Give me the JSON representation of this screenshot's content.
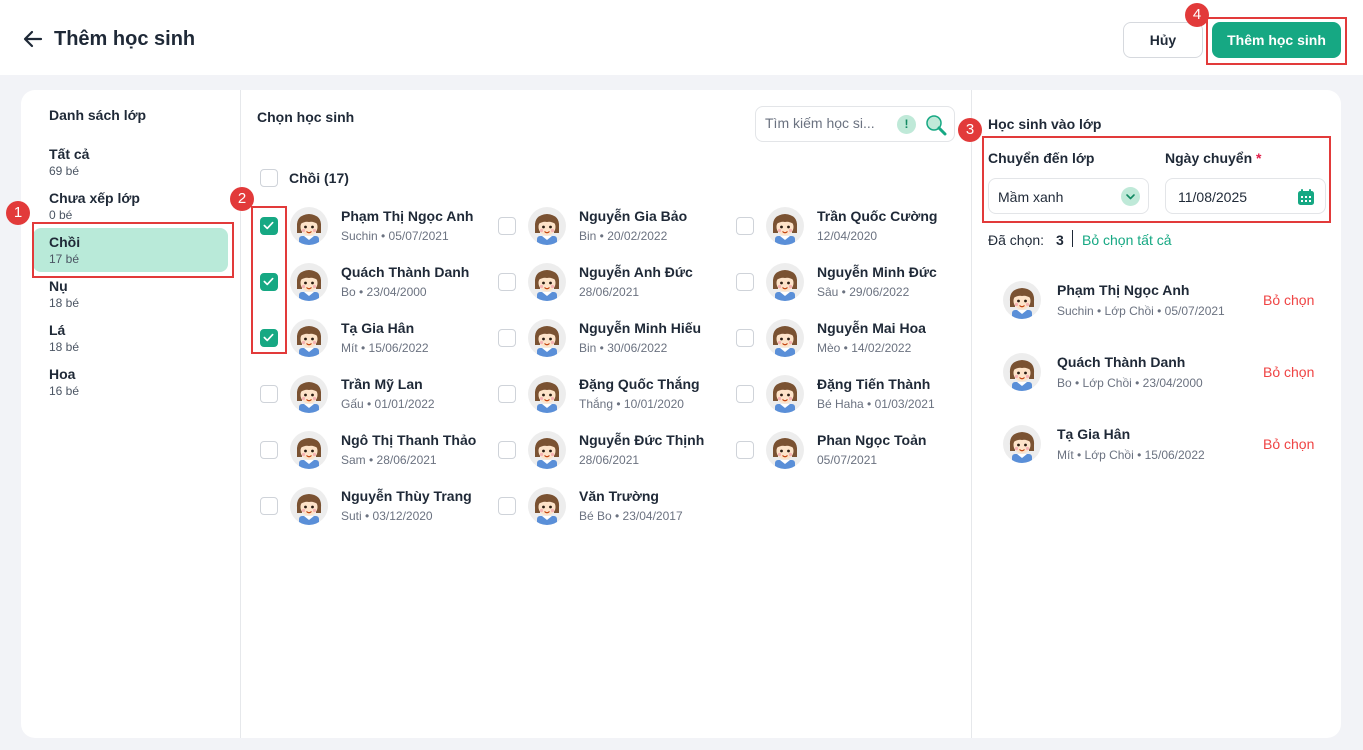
{
  "header": {
    "title": "Thêm học sinh",
    "cancel_label": "Hủy",
    "submit_label": "Thêm học sinh"
  },
  "sidebar": {
    "title": "Danh sách lớp",
    "items": [
      {
        "name": "Tất cả",
        "count": "69 bé"
      },
      {
        "name": "Chưa xếp lớp",
        "count": "0 bé"
      },
      {
        "name": "Chồi",
        "count": "17 bé"
      },
      {
        "name": "Nụ",
        "count": "18 bé"
      },
      {
        "name": "Lá",
        "count": "18 bé"
      },
      {
        "name": "Hoa",
        "count": "16 bé"
      }
    ],
    "active_index": 2
  },
  "picker": {
    "title": "Chọn học sinh",
    "search_placeholder": "Tìm kiếm học si...",
    "group_label": "Chồi (17)",
    "students": [
      {
        "name": "Phạm Thị Ngọc Anh",
        "meta": "Suchin  •  05/07/2021",
        "checked": true
      },
      {
        "name": "Nguyễn Gia Bảo",
        "meta": "Bin  •  20/02/2022",
        "checked": false
      },
      {
        "name": "Trần Quốc Cường",
        "meta": "12/04/2020",
        "checked": false
      },
      {
        "name": "Quách Thành Danh",
        "meta": "Bo  •  23/04/2000",
        "checked": true
      },
      {
        "name": "Nguyễn Anh Đức",
        "meta": "28/06/2021",
        "checked": false
      },
      {
        "name": "Nguyễn Minh Đức",
        "meta": "Sâu  •  29/06/2022",
        "checked": false
      },
      {
        "name": "Tạ Gia Hân",
        "meta": "Mít  •  15/06/2022",
        "checked": true
      },
      {
        "name": "Nguyễn Minh Hiếu",
        "meta": "Bin  •  30/06/2022",
        "checked": false
      },
      {
        "name": "Nguyễn Mai Hoa",
        "meta": "Mèo  •  14/02/2022",
        "checked": false
      },
      {
        "name": "Trần Mỹ Lan",
        "meta": "Gấu  •  01/01/2022",
        "checked": false
      },
      {
        "name": "Đặng Quốc Thắng",
        "meta": "Thắng  •  10/01/2020",
        "checked": false
      },
      {
        "name": "Đặng Tiến Thành",
        "meta": "Bé Haha  •  01/03/2021",
        "checked": false
      },
      {
        "name": "Ngô Thị Thanh Thảo",
        "meta": "Sam  •  28/06/2021",
        "checked": false
      },
      {
        "name": "Nguyễn Đức Thịnh",
        "meta": "28/06/2021",
        "checked": false
      },
      {
        "name": "Phan Ngọc Toản",
        "meta": "05/07/2021",
        "checked": false
      },
      {
        "name": "Nguyễn Thùy Trang",
        "meta": "Suti  •  03/12/2020",
        "checked": false
      },
      {
        "name": "Văn Trường",
        "meta": "Bé Bo  •  23/04/2017",
        "checked": false
      }
    ]
  },
  "transfer": {
    "title": "Học sinh vào lớp",
    "class_label": "Chuyển đến lớp",
    "class_value": "Mầm xanh",
    "date_label": "Ngày chuyển",
    "required_mark": "*",
    "date_value": "11/08/2025",
    "chosen_label": "Đã chọn:",
    "chosen_count": "3",
    "clear_all_label": "Bỏ chọn tất cả",
    "remove_label": "Bỏ chọn",
    "selected": [
      {
        "name": "Phạm Thị Ngọc Anh",
        "meta": "Suchin  •  Lớp Chồi  •  05/07/2021"
      },
      {
        "name": "Quách Thành Danh",
        "meta": "Bo  •  Lớp Chồi  •  23/04/2000"
      },
      {
        "name": "Tạ Gia Hân",
        "meta": "Mít  •  Lớp Chồi  •  15/06/2022"
      }
    ]
  },
  "annotations": {
    "badges": [
      "1",
      "2",
      "3",
      "4"
    ],
    "color": "#e23a3a"
  },
  "colors": {
    "accent": "#16a883",
    "active_class_bg": "#b9ead9",
    "remove": "#ef4444"
  }
}
